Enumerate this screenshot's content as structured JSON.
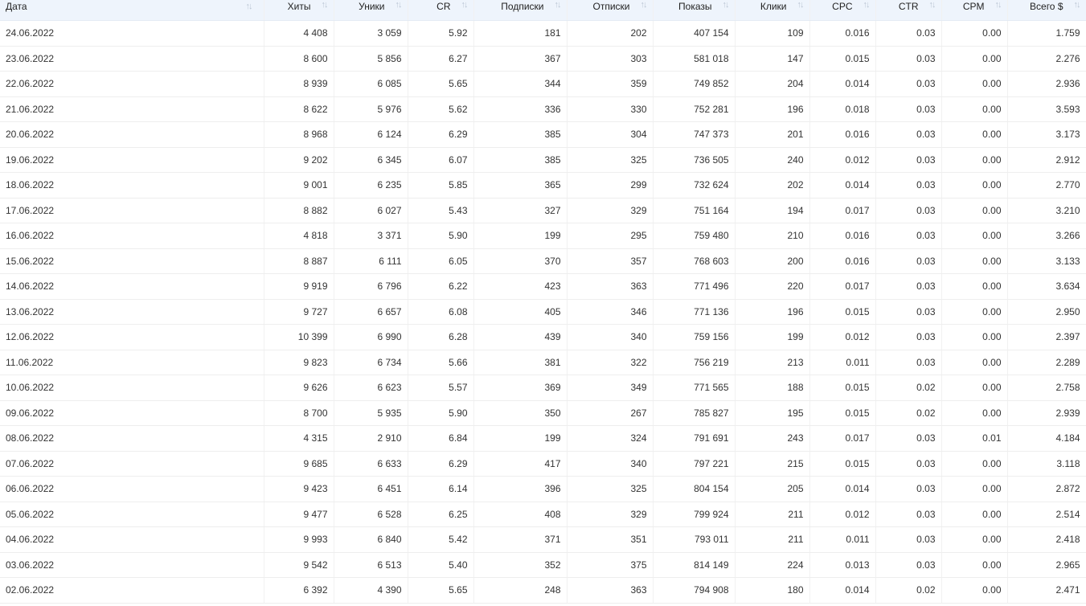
{
  "table": {
    "columns": [
      "Дата",
      "Хиты",
      "Уники",
      "CR",
      "Подписки",
      "Отписки",
      "Показы",
      "Клики",
      "CPC",
      "CTR",
      "CPM",
      "Всего $"
    ],
    "sort_icon": "sort-updown-icon",
    "rows": [
      [
        "24.06.2022",
        "4 408",
        "3 059",
        "5.92",
        "181",
        "202",
        "407 154",
        "109",
        "0.016",
        "0.03",
        "0.00",
        "1.759"
      ],
      [
        "23.06.2022",
        "8 600",
        "5 856",
        "6.27",
        "367",
        "303",
        "581 018",
        "147",
        "0.015",
        "0.03",
        "0.00",
        "2.276"
      ],
      [
        "22.06.2022",
        "8 939",
        "6 085",
        "5.65",
        "344",
        "359",
        "749 852",
        "204",
        "0.014",
        "0.03",
        "0.00",
        "2.936"
      ],
      [
        "21.06.2022",
        "8 622",
        "5 976",
        "5.62",
        "336",
        "330",
        "752 281",
        "196",
        "0.018",
        "0.03",
        "0.00",
        "3.593"
      ],
      [
        "20.06.2022",
        "8 968",
        "6 124",
        "6.29",
        "385",
        "304",
        "747 373",
        "201",
        "0.016",
        "0.03",
        "0.00",
        "3.173"
      ],
      [
        "19.06.2022",
        "9 202",
        "6 345",
        "6.07",
        "385",
        "325",
        "736 505",
        "240",
        "0.012",
        "0.03",
        "0.00",
        "2.912"
      ],
      [
        "18.06.2022",
        "9 001",
        "6 235",
        "5.85",
        "365",
        "299",
        "732 624",
        "202",
        "0.014",
        "0.03",
        "0.00",
        "2.770"
      ],
      [
        "17.06.2022",
        "8 882",
        "6 027",
        "5.43",
        "327",
        "329",
        "751 164",
        "194",
        "0.017",
        "0.03",
        "0.00",
        "3.210"
      ],
      [
        "16.06.2022",
        "4 818",
        "3 371",
        "5.90",
        "199",
        "295",
        "759 480",
        "210",
        "0.016",
        "0.03",
        "0.00",
        "3.266"
      ],
      [
        "15.06.2022",
        "8 887",
        "6 111",
        "6.05",
        "370",
        "357",
        "768 603",
        "200",
        "0.016",
        "0.03",
        "0.00",
        "3.133"
      ],
      [
        "14.06.2022",
        "9 919",
        "6 796",
        "6.22",
        "423",
        "363",
        "771 496",
        "220",
        "0.017",
        "0.03",
        "0.00",
        "3.634"
      ],
      [
        "13.06.2022",
        "9 727",
        "6 657",
        "6.08",
        "405",
        "346",
        "771 136",
        "196",
        "0.015",
        "0.03",
        "0.00",
        "2.950"
      ],
      [
        "12.06.2022",
        "10 399",
        "6 990",
        "6.28",
        "439",
        "340",
        "759 156",
        "199",
        "0.012",
        "0.03",
        "0.00",
        "2.397"
      ],
      [
        "11.06.2022",
        "9 823",
        "6 734",
        "5.66",
        "381",
        "322",
        "756 219",
        "213",
        "0.011",
        "0.03",
        "0.00",
        "2.289"
      ],
      [
        "10.06.2022",
        "9 626",
        "6 623",
        "5.57",
        "369",
        "349",
        "771 565",
        "188",
        "0.015",
        "0.02",
        "0.00",
        "2.758"
      ],
      [
        "09.06.2022",
        "8 700",
        "5 935",
        "5.90",
        "350",
        "267",
        "785 827",
        "195",
        "0.015",
        "0.02",
        "0.00",
        "2.939"
      ],
      [
        "08.06.2022",
        "4 315",
        "2 910",
        "6.84",
        "199",
        "324",
        "791 691",
        "243",
        "0.017",
        "0.03",
        "0.01",
        "4.184"
      ],
      [
        "07.06.2022",
        "9 685",
        "6 633",
        "6.29",
        "417",
        "340",
        "797 221",
        "215",
        "0.015",
        "0.03",
        "0.00",
        "3.118"
      ],
      [
        "06.06.2022",
        "9 423",
        "6 451",
        "6.14",
        "396",
        "325",
        "804 154",
        "205",
        "0.014",
        "0.03",
        "0.00",
        "2.872"
      ],
      [
        "05.06.2022",
        "9 477",
        "6 528",
        "6.25",
        "408",
        "329",
        "799 924",
        "211",
        "0.012",
        "0.03",
        "0.00",
        "2.514"
      ],
      [
        "04.06.2022",
        "9 993",
        "6 840",
        "5.42",
        "371",
        "351",
        "793 011",
        "211",
        "0.011",
        "0.03",
        "0.00",
        "2.418"
      ],
      [
        "03.06.2022",
        "9 542",
        "6 513",
        "5.40",
        "352",
        "375",
        "814 149",
        "224",
        "0.013",
        "0.03",
        "0.00",
        "2.965"
      ],
      [
        "02.06.2022",
        "6 392",
        "4 390",
        "5.65",
        "248",
        "363",
        "794 908",
        "180",
        "0.014",
        "0.02",
        "0.00",
        "2.471"
      ]
    ]
  }
}
